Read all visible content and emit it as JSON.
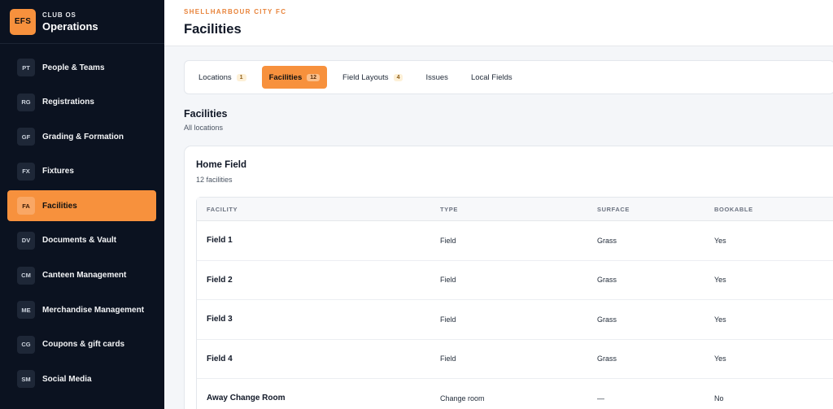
{
  "brand": {
    "badge": "EFS",
    "subtitle": "CLUB OS",
    "title": "Operations"
  },
  "sidebar": {
    "items": [
      {
        "abbr": "PT",
        "label": "People & Teams"
      },
      {
        "abbr": "RG",
        "label": "Registrations"
      },
      {
        "abbr": "GF",
        "label": "Grading & Formation"
      },
      {
        "abbr": "FX",
        "label": "Fixtures"
      },
      {
        "abbr": "FA",
        "label": "Facilities",
        "active": true
      },
      {
        "abbr": "DV",
        "label": "Documents & Vault"
      },
      {
        "abbr": "CM",
        "label": "Canteen Management"
      },
      {
        "abbr": "ME",
        "label": "Merchandise Management"
      },
      {
        "abbr": "CG",
        "label": "Coupons & gift cards"
      },
      {
        "abbr": "SM",
        "label": "Social Media"
      }
    ]
  },
  "header": {
    "club": "SHELLHARBOUR CITY FC",
    "title": "Facilities"
  },
  "tabs": [
    {
      "label": "Locations",
      "count": "1"
    },
    {
      "label": "Facilities",
      "count": "12",
      "active": true
    },
    {
      "label": "Field Layouts",
      "count": "4"
    },
    {
      "label": "Issues",
      "count": ""
    },
    {
      "label": "Local Fields",
      "count": ""
    }
  ],
  "section": {
    "title": "Facilities",
    "subtitle": "All locations"
  },
  "card": {
    "title": "Home Field",
    "subtitle": "12 facilities"
  },
  "table": {
    "headers": [
      "FACILITY",
      "TYPE",
      "SURFACE",
      "BOOKABLE"
    ],
    "rows": [
      [
        "Field 1",
        "Field",
        "Grass",
        "Yes"
      ],
      [
        "Field 2",
        "Field",
        "Grass",
        "Yes"
      ],
      [
        "Field 3",
        "Field",
        "Grass",
        "Yes"
      ],
      [
        "Field 4",
        "Field",
        "Grass",
        "Yes"
      ],
      [
        "Away Change Room",
        "Change room",
        "—",
        "No"
      ]
    ]
  },
  "colors": {
    "accent": "#f7913d",
    "sidebar_bg": "#0b1220",
    "club_name": "#e8833a"
  }
}
